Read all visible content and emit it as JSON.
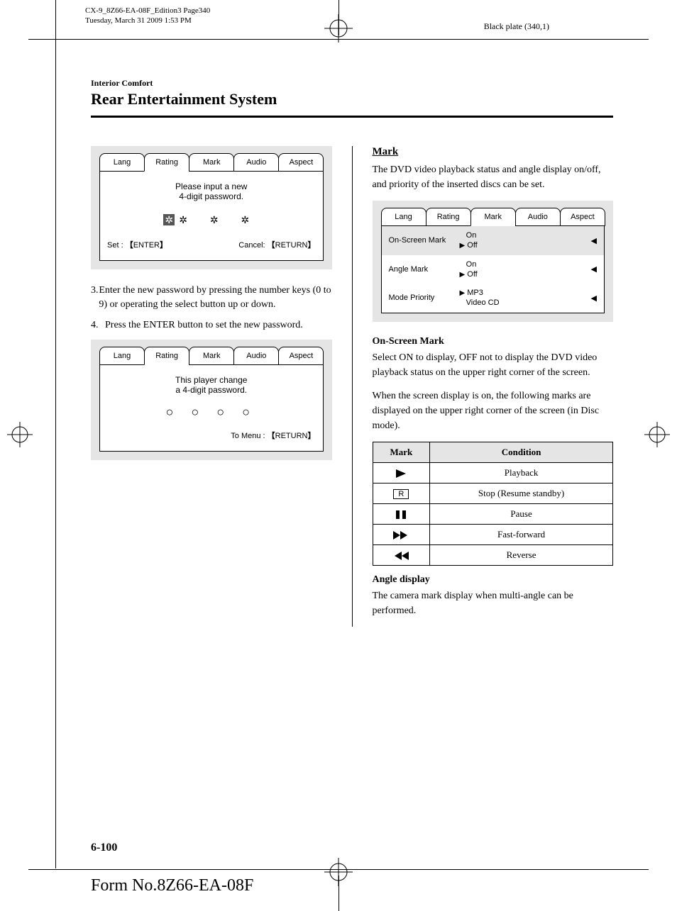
{
  "meta": {
    "doc_id_line1": "CX-9_8Z66-EA-08F_Edition3 Page340",
    "doc_id_line2": "Tuesday, March 31 2009 1:53 PM",
    "black_plate": "Black plate (340,1)",
    "page_number": "6-100",
    "form_number": "Form No.8Z66-EA-08F"
  },
  "header": {
    "category": "Interior Comfort",
    "title": "Rear Entertainment System"
  },
  "tabs": [
    "Lang",
    "Rating",
    "Mark",
    "Audio",
    "Aspect"
  ],
  "left": {
    "screen1": {
      "line1": "Please input a new",
      "line2": "4-digit password.",
      "set_label": "Set :",
      "set_btn": "ENTER",
      "cancel_label": "Cancel:",
      "cancel_btn": "RETURN"
    },
    "step3_num": "3.",
    "step3": "Enter the new password by pressing the number keys (0 to 9) or operating the select button up or down.",
    "step4_num": "4.",
    "step4": "Press the ENTER button to set the new password.",
    "screen2": {
      "line1": "This player change",
      "line2": "a 4-digit password.",
      "menu_label": "To Menu :",
      "menu_btn": "RETURN"
    }
  },
  "right": {
    "mark_heading": "Mark",
    "mark_intro": "The DVD video playback status and angle display on/off, and priority of the inserted discs can be set.",
    "mark_screen": {
      "rows": [
        {
          "label": "On-Screen Mark",
          "opt1": "On",
          "opt2": "Off",
          "sel": 2,
          "shaded": true
        },
        {
          "label": "Angle Mark",
          "opt1": "On",
          "opt2": "Off",
          "sel": 2,
          "shaded": false
        },
        {
          "label": "Mode Priority",
          "opt1": "MP3",
          "opt2": "Video CD",
          "sel": 1,
          "shaded": false
        }
      ]
    },
    "onscreen_heading": "On-Screen Mark",
    "onscreen_p1": "Select ON to display, OFF not to display the DVD video playback status on the upper right corner of the screen.",
    "onscreen_p2": "When the screen display is on, the following marks are displayed on the upper right corner of the screen (in Disc mode).",
    "table": {
      "head_mark": "Mark",
      "head_cond": "Condition",
      "rows": [
        {
          "icon": "play",
          "cond": "Playback"
        },
        {
          "icon": "r",
          "cond": "Stop (Resume standby)"
        },
        {
          "icon": "pause",
          "cond": "Pause"
        },
        {
          "icon": "ff",
          "cond": "Fast-forward"
        },
        {
          "icon": "rw",
          "cond": "Reverse"
        }
      ]
    },
    "angle_heading": "Angle display",
    "angle_text": "The camera mark display when multi-angle can be performed."
  }
}
